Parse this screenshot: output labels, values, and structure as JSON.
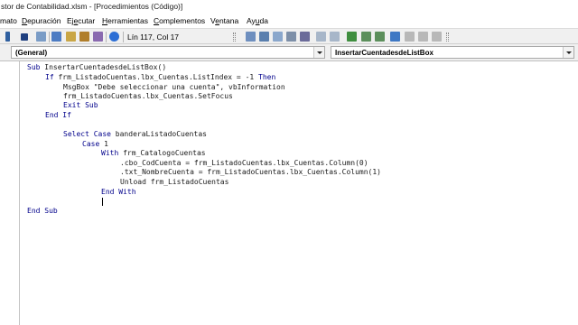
{
  "window": {
    "title": "stor de Contabilidad.xlsm - [Procedimientos (Código)]"
  },
  "menu": {
    "items": [
      {
        "pre": "",
        "ul": "",
        "post": "mato"
      },
      {
        "pre": "",
        "ul": "D",
        "post": "epuración"
      },
      {
        "pre": "Ej",
        "ul": "e",
        "post": "cutar"
      },
      {
        "pre": "",
        "ul": "H",
        "post": "erramientas"
      },
      {
        "pre": "",
        "ul": "C",
        "post": "omplementos"
      },
      {
        "pre": "V",
        "ul": "e",
        "post": "ntana"
      },
      {
        "pre": "Ay",
        "ul": "u",
        "post": "da"
      }
    ]
  },
  "toolbar": {
    "cursor_position": "Lín 117, Col 17"
  },
  "dropdowns": {
    "object": "(General)",
    "procedure": "InsertarCuentadesdeListBox"
  },
  "code": {
    "lines": [
      [
        {
          "k": "Sub",
          "t": " InsertarCuentadesdeListBox()"
        }
      ],
      [
        {
          "k": "If",
          "t": " frm_ListadoCuentas.lbx_Cuentas.ListIndex = -1 "
        },
        {
          "k": "Then",
          "t": ""
        }
      ],
      [
        {
          "k": "",
          "t": "MsgBox \"Debe seleccionar una cuenta\", vbInformation"
        }
      ],
      [
        {
          "k": "",
          "t": "frm_ListadoCuentas.lbx_Cuentas.SetFocus"
        }
      ],
      [
        {
          "k": "Exit Sub",
          "t": ""
        }
      ],
      [
        {
          "k": "End If",
          "t": ""
        }
      ],
      [
        {
          "k": "",
          "t": ""
        }
      ],
      [
        {
          "k": "Select Case",
          "t": " banderaListadoCuentas"
        }
      ],
      [
        {
          "k": "Case",
          "t": " 1"
        }
      ],
      [
        {
          "k": "With",
          "t": " frm_CatalogoCuentas"
        }
      ],
      [
        {
          "k": "",
          "t": ".cbo_CodCuenta = frm_ListadoCuentas.lbx_Cuentas.Column(0)"
        }
      ],
      [
        {
          "k": "",
          "t": ".txt_NombreCuenta = frm_ListadoCuentas.lbx_Cuentas.Column(1)"
        }
      ],
      [
        {
          "k": "",
          "t": "Unload frm_ListadoCuentas"
        }
      ],
      [
        {
          "k": "End With",
          "t": ""
        }
      ],
      [
        {
          "k": "",
          "t": ""
        }
      ],
      [
        {
          "k": "",
          "t": ""
        }
      ],
      [
        {
          "k": "End Sub",
          "t": ""
        }
      ]
    ]
  },
  "colors": {
    "keyword": "#00008b",
    "text": "#1a1a1a",
    "toolbar_bg": "#f0f0f0"
  }
}
